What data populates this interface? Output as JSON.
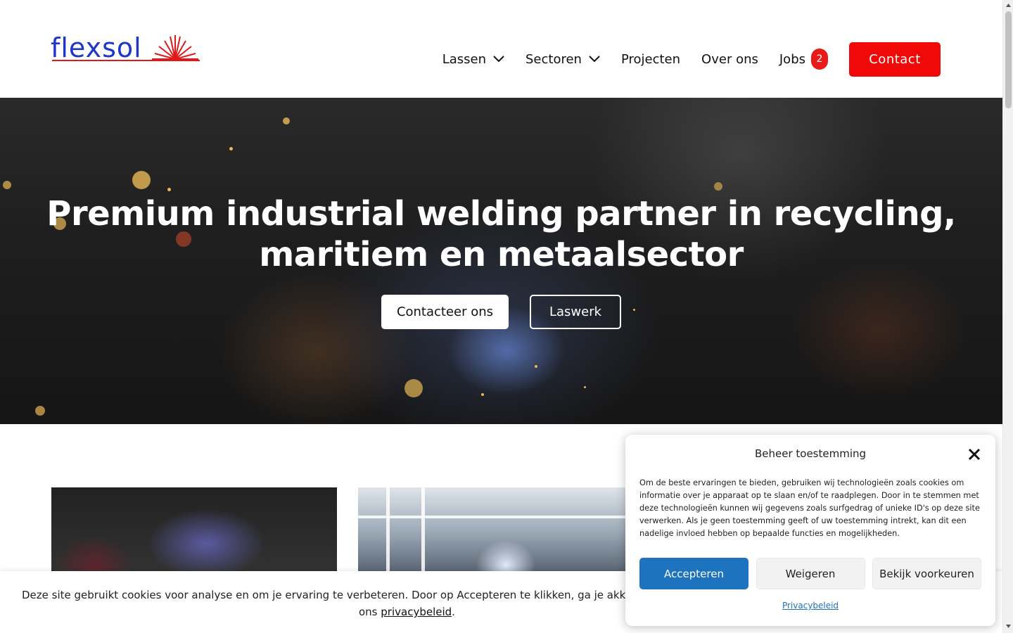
{
  "header": {
    "logo_text": "flexsol",
    "nav": [
      {
        "label": "Lassen",
        "has_dropdown": true
      },
      {
        "label": "Sectoren",
        "has_dropdown": true
      },
      {
        "label": "Projecten",
        "has_dropdown": false
      },
      {
        "label": "Over ons",
        "has_dropdown": false
      },
      {
        "label": "Jobs",
        "has_dropdown": false
      }
    ],
    "jobs_badge": "2",
    "contact_label": "Contact",
    "colors": {
      "brand_blue": "#1f37c9",
      "brand_red": "#f10808"
    }
  },
  "hero": {
    "title_line1": "Premium industrial welding partner in recycling,",
    "title_line2": "maritiem en metaalsector",
    "primary_button": "Contacteer ons",
    "secondary_button": "Laswerk"
  },
  "cookie_bar": {
    "text": "Deze site gebruikt cookies voor analyse en om je ervaring te verbeteren. Door op Accepteren te klikken, ga je akkoord met ons ge",
    "text_line2_prefix": "ons ",
    "link_label": "privacybeleid",
    "text_suffix": "."
  },
  "consent_modal": {
    "title": "Beheer toestemming",
    "body": "Om de beste ervaringen te bieden, gebruiken wij technologieën zoals cookies om informatie over je apparaat op te slaan en/of te raadplegen. Door in te stemmen met deze technologieën kunnen wij gegevens zoals surfgedrag of unieke ID's op deze site verwerken. Als je geen toestemming geeft of uw toestemming intrekt, kan dit een nadelige invloed hebben op bepaalde functies en mogelijkheden.",
    "accept_label": "Accepteren",
    "deny_label": "Weigeren",
    "prefs_label": "Bekijk voorkeuren",
    "privacy_link": "Privacybeleid",
    "accent_color": "#1e73be"
  }
}
